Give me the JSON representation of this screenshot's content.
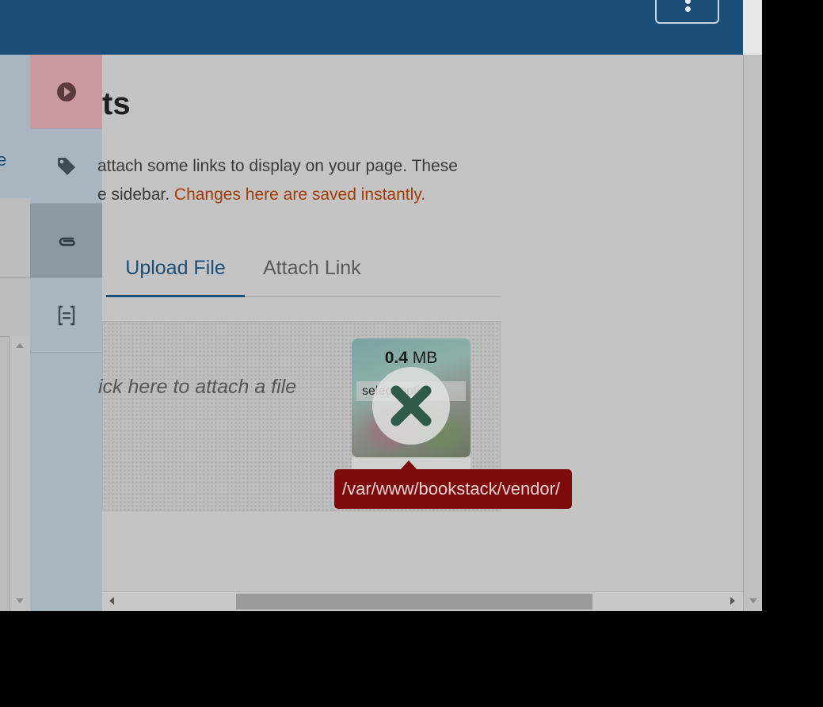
{
  "topbar": {
    "menu_icon": "more-vertical-icon"
  },
  "sidebar_peek": {
    "text": "e"
  },
  "toolbox": {
    "tools": [
      {
        "icon": "play-circle-icon",
        "state": "active"
      },
      {
        "icon": "tag-icon"
      },
      {
        "icon": "paperclip-icon",
        "state": "selected"
      },
      {
        "icon": "list-document-icon"
      }
    ]
  },
  "attachments": {
    "title": "ts",
    "description_line1": "attach some links to display on your page. These",
    "description_line2": "e sidebar. ",
    "description_warning": "Changes here are saved instantly.",
    "tabs": {
      "upload": "Upload File",
      "link": "Attach Link"
    },
    "dropzone_text": "ick here to attach a file",
    "file": {
      "size_value": "0.4",
      "size_unit": " MB",
      "name": "select-opti...",
      "error_icon": "close-circle-icon"
    },
    "error_tooltip": "/var/www/bookstack/vendor/"
  },
  "colors": {
    "header": "#1b4f78",
    "accent": "#1b4f78",
    "warning": "#a23c05",
    "error": "#7e0b0b"
  }
}
